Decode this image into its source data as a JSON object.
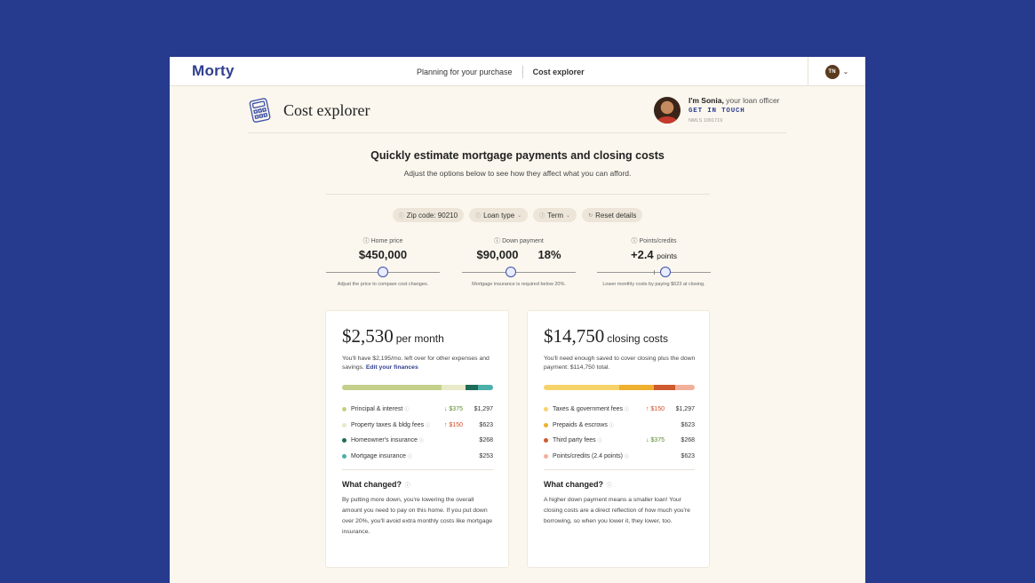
{
  "app": {
    "logo": "Morty",
    "nav": {
      "planning": "Planning for your purchase",
      "explorer": "Cost explorer"
    },
    "user_initials": "TN"
  },
  "header": {
    "title": "Cost explorer",
    "officer_name": "I'm Sonia,",
    "officer_role": " your loan officer",
    "officer_cta": "GET IN TOUCH",
    "officer_nmls": "NMLS 1091719"
  },
  "hero": {
    "title": "Quickly estimate mortgage payments and closing costs",
    "subtitle": "Adjust the options below to see how they affect what you can afford."
  },
  "filters": {
    "zip": "Zip code: 90210",
    "loan_type": "Loan type",
    "term": "Term",
    "reset": "Reset details"
  },
  "sliders": {
    "home_price": {
      "label": "Home price",
      "value": "$450,000",
      "hint": "Adjust the price to compare cost changes.",
      "level": 0.5
    },
    "down_payment": {
      "label": "Down payment",
      "value": "$90,000",
      "percent": "18%",
      "hint": "Mortgage insurance is required below 20%.",
      "level": 0.43
    },
    "points": {
      "label": "Points/credits",
      "value": "+2.4",
      "unit": "points",
      "hint": "Lower monthly costs by paying $623 at closing.",
      "level": 0.6
    }
  },
  "monthly": {
    "amount": "$2,530",
    "suffix": "per month",
    "desc": "You'll have $2,195/mo. left over for other expenses and savings.",
    "link": "Edit your finances",
    "items": [
      {
        "label": "Principal & interest",
        "delta": "↓ $375",
        "dir": "down",
        "amount": "$1,297",
        "color": "#c4d08a",
        "share": 0.66
      },
      {
        "label": "Property taxes & bldg fees",
        "delta": "↑ $150",
        "dir": "up",
        "amount": "$623",
        "color": "#e8eac8",
        "share": 0.16
      },
      {
        "label": "Homeowner's insurance",
        "delta": "",
        "dir": "",
        "amount": "$268",
        "color": "#1f6b5a",
        "share": 0.08
      },
      {
        "label": "Mortgage insurance",
        "delta": "",
        "dir": "",
        "amount": "$253",
        "color": "#4bb0a8",
        "share": 0.1
      }
    ],
    "changed_title": "What changed?",
    "changed_body": "By putting more down, you're lowering the overall amount you need to pay on this home. If you put down over 20%, you'll avoid extra monthly costs like mortgage insurance."
  },
  "closing": {
    "amount": "$14,750",
    "suffix": "closing costs",
    "desc": "You'll need enough saved to cover closing plus the down payment: $114,750 total.",
    "items": [
      {
        "label": "Taxes & government fees",
        "delta": "↑ $150",
        "dir": "up",
        "amount": "$1,297",
        "color": "#f6d36a",
        "share": 0.5
      },
      {
        "label": "Prepaids & escrows",
        "delta": "",
        "dir": "",
        "amount": "$623",
        "color": "#efb030",
        "share": 0.23
      },
      {
        "label": "Third party fees",
        "delta": "↓ $375",
        "dir": "down",
        "amount": "$268",
        "color": "#cf5a2e",
        "share": 0.14
      },
      {
        "label": "Points/credits (2.4 points)",
        "delta": "",
        "dir": "",
        "amount": "$623",
        "color": "#f2b09a",
        "share": 0.13
      }
    ],
    "changed_title": "What changed?",
    "changed_body": "A higher down payment means a smaller loan! Your closing costs are a direct reflection of how much you're borrowing, so when you lower it, they lower, too."
  }
}
